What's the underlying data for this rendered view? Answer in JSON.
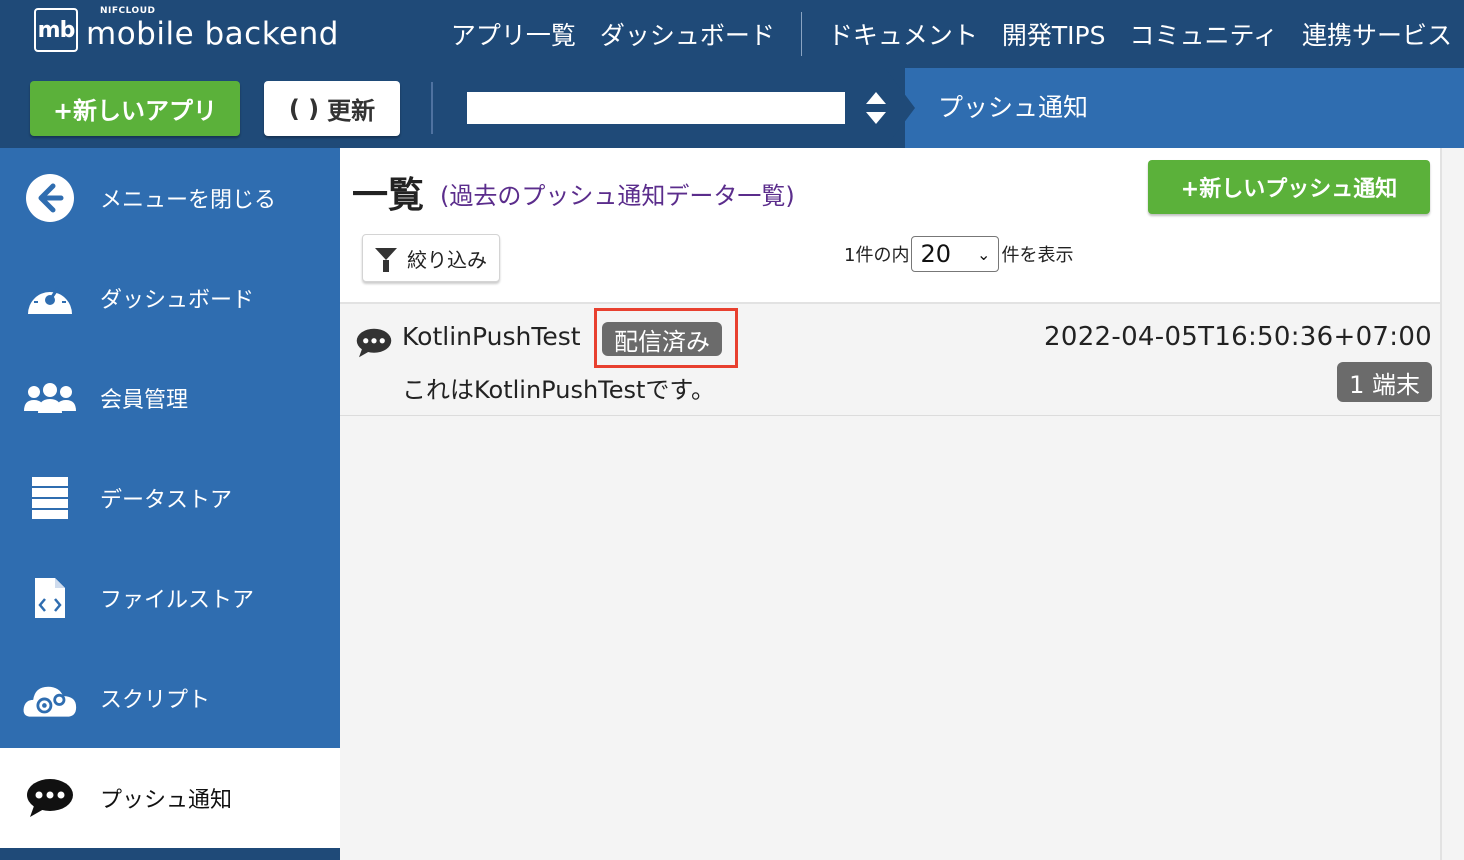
{
  "brand": {
    "logo_mark": "mb",
    "logo_sub": "NIFCLOUD",
    "logo_main": "mobile backend"
  },
  "topnav": {
    "items": [
      "アプリ一覧",
      "ダッシュボード",
      "ドキュメント",
      "開発TIPS",
      "コミュニティ",
      "連携サービス"
    ]
  },
  "toolbar": {
    "new_app_label": "+新しいアプリ",
    "refresh_label": "更新",
    "refresh_icon": "refresh-icon",
    "app_select_value": "",
    "breadcrumb": "プッシュ通知"
  },
  "sidebar": {
    "items": [
      {
        "label": "メニューを閉じる",
        "icon": "back-arrow-icon"
      },
      {
        "label": "ダッシュボード",
        "icon": "gauge-icon"
      },
      {
        "label": "会員管理",
        "icon": "users-icon"
      },
      {
        "label": "データストア",
        "icon": "database-icon"
      },
      {
        "label": "ファイルストア",
        "icon": "file-code-icon"
      },
      {
        "label": "スクリプト",
        "icon": "cloud-gear-icon"
      },
      {
        "label": "プッシュ通知",
        "icon": "chat-bubble-icon"
      }
    ]
  },
  "main": {
    "title": "一覧",
    "subtitle": "(過去のプッシュ通知データ一覧)",
    "new_push_label": "+新しいプッシュ通知",
    "filter_label": "絞り込み",
    "paging_prefix": "1件の内",
    "per_page": "20",
    "paging_suffix": "件を表示",
    "rows": [
      {
        "name": "KotlinPushTest",
        "status": "配信済み",
        "timestamp": "2022-04-05T16:50:36+07:00",
        "message": "これはKotlinPushTestです。",
        "devices": "1 端末"
      }
    ]
  },
  "colors": {
    "nav_dark": "#1f4a78",
    "nav_blue": "#2f6db0",
    "accent_green": "#5bb13a",
    "badge_gray": "#6b6b6b",
    "highlight_red": "#e8402f",
    "subtitle_purple": "#5b2d8c"
  }
}
